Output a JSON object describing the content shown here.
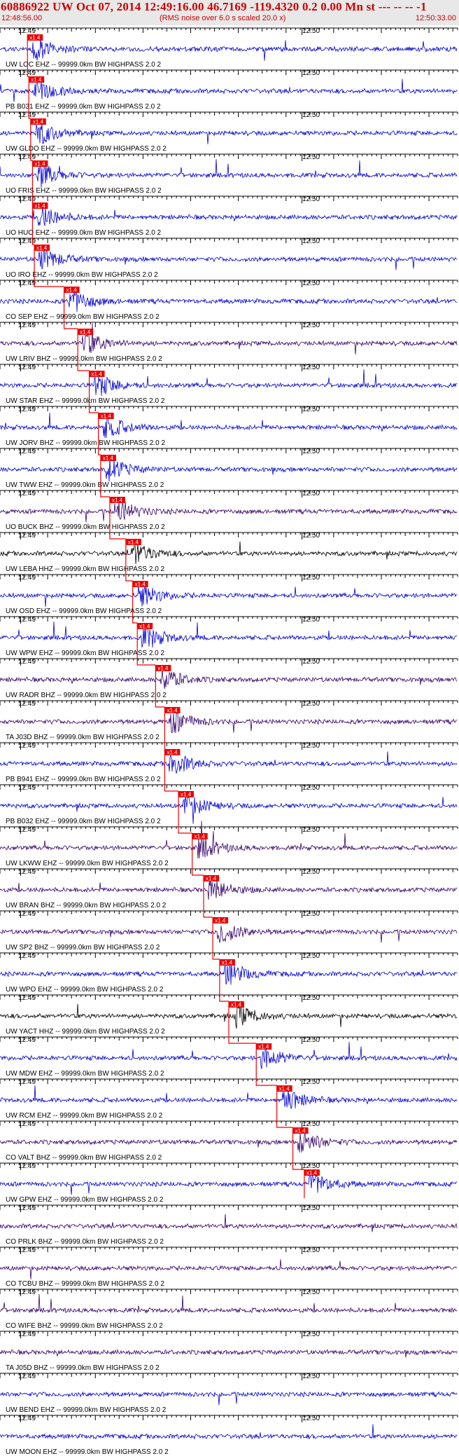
{
  "header": {
    "title": "60886922 UW Oct 07, 2014 12:49:16.00   46.7169 -119.4320  0.2 0.00 Mn st --- -- --  -1",
    "start_time": "12:48:56.00",
    "rms_note": "(RMS noise over 6.0 s scaled 20.0 x)",
    "end_time": "12:50:33.00"
  },
  "time_labels": {
    "minute_a": "12:49",
    "minute_b": "12:50"
  },
  "colors": {
    "header_text": "#cc0000",
    "trace_blue": "#0000cc",
    "trace_purple": "#330066",
    "trace_black": "#000000",
    "pick_red": "#ee0000",
    "grid": "#000000"
  },
  "pick_label": "x1.4",
  "traces": [
    {
      "label": "UW LOC  EHZ -- 99999.0km BW  HIGHPASS  2.0  2",
      "color": "#0000cc",
      "pick": 0.06
    },
    {
      "label": "PB B031 EHZ -- 99999.0km BW  HIGHPASS  2.0  2",
      "color": "#0000cc",
      "pick": 0.063
    },
    {
      "label": "UW GLDO EHZ -- 99999.0km BW  HIGHPASS  2.0  2",
      "color": "#0000cc",
      "pick": 0.067
    },
    {
      "label": "UO FRIS EHZ -- 99999.0km BW  HIGHPASS  2.0  2",
      "color": "#0000cc",
      "pick": 0.071
    },
    {
      "label": "UO HUO  EHZ -- 99999.0km BW  HIGHPASS  2.0  2",
      "color": "#0000cc",
      "pick": 0.071
    },
    {
      "label": "UO IRO  EHZ -- 99999.0km BW  HIGHPASS  2.0  2",
      "color": "#0000cc",
      "pick": 0.075
    },
    {
      "label": "CO SEP  EHZ -- 99999.0km BW  HIGHPASS  2.0  2",
      "color": "#0000cc",
      "pick": 0.14
    },
    {
      "label": "UW LRIV BHZ -- 99999.0km BW  HIGHPASS  2.0  2",
      "color": "#330066",
      "pick": 0.17
    },
    {
      "label": "UW STAR EHZ -- 99999.0km BW  HIGHPASS  2.0  2",
      "color": "#0000cc",
      "pick": 0.195
    },
    {
      "label": "UW JORV BHZ -- 99999.0km BW  HIGHPASS  2.0  2",
      "color": "#0000cc",
      "pick": 0.215
    },
    {
      "label": "UW TWW  EHZ -- 99999.0km BW  HIGHPASS  2.0  2",
      "color": "#0000cc",
      "pick": 0.22
    },
    {
      "label": "UO BUCK BHZ -- 99999.0km BW  HIGHPASS  2.0  2",
      "color": "#330066",
      "pick": 0.24
    },
    {
      "label": "UW LEBA HHZ -- 99999.0km BW  HIGHPASS  2.0  2",
      "color": "#000000",
      "pick": 0.275
    },
    {
      "label": "UW OSD  EHZ -- 99999.0km BW  HIGHPASS  2.0  2",
      "color": "#0000cc",
      "pick": 0.29
    },
    {
      "label": "UW WPW  EHZ -- 99999.0km BW  HIGHPASS  2.0  2",
      "color": "#0000cc",
      "pick": 0.3
    },
    {
      "label": "UW RADR BHZ -- 99999.0km BW  HIGHPASS  2.0  2",
      "color": "#330066",
      "pick": 0.34
    },
    {
      "label": "TA J03D BHZ -- 99999.0km BW  HIGHPASS  2.0  2",
      "color": "#330066",
      "pick": 0.36
    },
    {
      "label": "PB B941 EHZ -- 99999.0km BW  HIGHPASS  2.0  2",
      "color": "#0000cc",
      "pick": 0.36
    },
    {
      "label": "PB B032 EHZ -- 99999.0km BW  HIGHPASS  2.0  2",
      "color": "#0000cc",
      "pick": 0.39
    },
    {
      "label": "UW LKWW EHZ -- 99999.0km BW  HIGHPASS  2.0  2",
      "color": "#330066",
      "pick": 0.42
    },
    {
      "label": "UW BRAN BHZ -- 99999.0km BW  HIGHPASS  2.0  2",
      "color": "#330066",
      "pick": 0.445
    },
    {
      "label": "UW SP2  BHZ -- 99999.0km BW  HIGHPASS  2.0  2",
      "color": "#330066",
      "pick": 0.465
    },
    {
      "label": "UW WPO  EHZ -- 99999.0km BW  HIGHPASS  2.0  2",
      "color": "#0000cc",
      "pick": 0.48
    },
    {
      "label": "UW YACT HHZ -- 99999.0km BW  HIGHPASS  2.0  2",
      "color": "#000000",
      "pick": 0.5
    },
    {
      "label": "UW MDW  EHZ -- 99999.0km BW  HIGHPASS  2.0  2",
      "color": "#0000cc",
      "pick": 0.56
    },
    {
      "label": "UW RCM  EHZ -- 99999.0km BW  HIGHPASS  2.0  2",
      "color": "#0000cc",
      "pick": 0.605
    },
    {
      "label": "CO VALT BHZ -- 99999.0km BW  HIGHPASS  2.0  2",
      "color": "#330066",
      "pick": 0.64
    },
    {
      "label": "UW GPW  EHZ -- 99999.0km BW  HIGHPASS  2.0  2",
      "color": "#0000cc",
      "pick": 0.665
    },
    {
      "label": "CO PRLK BHZ -- 99999.0km BW  HIGHPASS  2.0  2",
      "color": "#330066",
      "pick": null
    },
    {
      "label": "CO TCBU BHZ -- 99999.0km BW  HIGHPASS  2.0  2",
      "color": "#330066",
      "pick": null
    },
    {
      "label": "CO WIFE BHZ -- 99999.0km BW  HIGHPASS  2.0  2",
      "color": "#330066",
      "pick": null
    },
    {
      "label": "TA J05D BHZ -- 99999.0km BW  HIGHPASS  2.0  2",
      "color": "#330066",
      "pick": null
    },
    {
      "label": "UW BEND EHZ -- 99999.0km BW  HIGHPASS  2.0  2",
      "color": "#0000cc",
      "pick": null
    },
    {
      "label": "UW MOON EHZ -- 99999.0km BW  HIGHPASS  2.0  2",
      "color": "#0000cc",
      "pick": null
    }
  ]
}
